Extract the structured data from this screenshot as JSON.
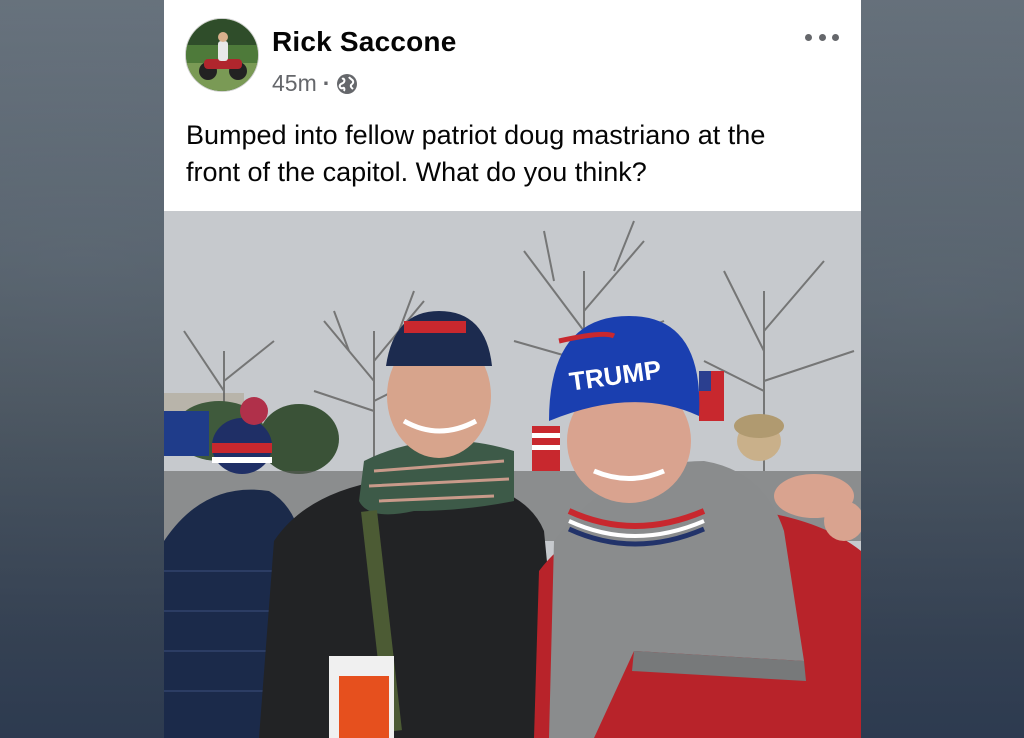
{
  "post": {
    "author": "Rick Saccone",
    "time": "45m",
    "separator": "·",
    "privacy_icon": "globe-icon",
    "more_icon": "more-options-icon",
    "text": "Bumped into fellow patriot doug mastriano at the front of the capitol. What do you think?"
  },
  "photo": {
    "hat_text": "TRUMP"
  },
  "colors": {
    "card_background": "#ffffff",
    "author_text": "#050505",
    "meta_text": "#65676b"
  }
}
